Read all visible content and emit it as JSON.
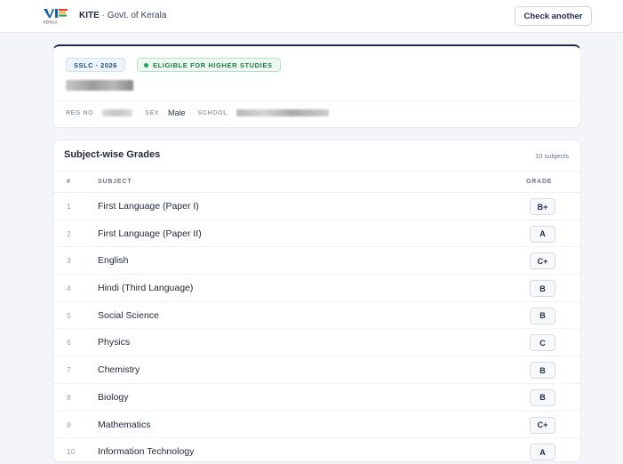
{
  "header": {
    "brand_name": "KITE",
    "brand_sep": "·",
    "brand_org": "Govt. of Kerala",
    "check_another": "Check another",
    "logo_icon": "kite-logo",
    "logo_text": "KERALA"
  },
  "student": {
    "exam_badge": "SSLC · 2026",
    "eligibility": "ELIGIBLE FOR HIGHER STUDIES",
    "reg_label": "REG NO",
    "sex_label": "SEX",
    "sex_value": "Male",
    "school_label": "SCHOOL"
  },
  "grades": {
    "title": "Subject-wise Grades",
    "count": "10 subjects",
    "col_num": "#",
    "col_subject": "SUBJECT",
    "col_grade": "GRADE",
    "rows": [
      {
        "num": "1",
        "subject": "First Language (Paper I)",
        "grade": "B+"
      },
      {
        "num": "2",
        "subject": "First Language (Paper II)",
        "grade": "A"
      },
      {
        "num": "3",
        "subject": "English",
        "grade": "C+"
      },
      {
        "num": "4",
        "subject": "Hindi (Third Language)",
        "grade": "B"
      },
      {
        "num": "5",
        "subject": "Social Science",
        "grade": "B"
      },
      {
        "num": "6",
        "subject": "Physics",
        "grade": "C"
      },
      {
        "num": "7",
        "subject": "Chemistry",
        "grade": "B"
      },
      {
        "num": "8",
        "subject": "Biology",
        "grade": "B"
      },
      {
        "num": "9",
        "subject": "Mathematics",
        "grade": "C+"
      },
      {
        "num": "10",
        "subject": "Information Technology",
        "grade": "A"
      }
    ]
  },
  "colors": {
    "accent": "#1f2a44",
    "eligible_green": "#1d7a45",
    "badge_blue": "#1f4e79"
  }
}
